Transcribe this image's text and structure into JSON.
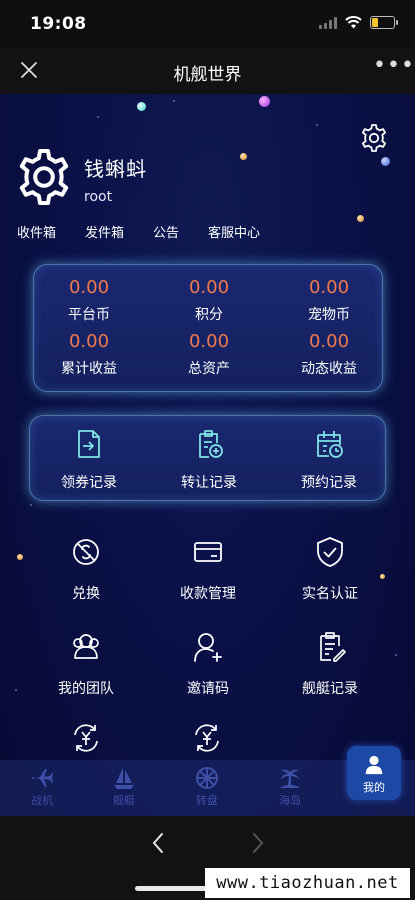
{
  "status_bar": {
    "time": "19:08"
  },
  "header": {
    "title": "机舰世界",
    "more": "•••"
  },
  "profile": {
    "username": "钱蝌蚪",
    "user_id": "root"
  },
  "quick_links": [
    "收件箱",
    "发件箱",
    "公告",
    "客服中心"
  ],
  "assets": [
    {
      "value": "0.00",
      "label": "平台币"
    },
    {
      "value": "0.00",
      "label": "积分"
    },
    {
      "value": "0.00",
      "label": "宠物币"
    },
    {
      "value": "0.00",
      "label": "累计收益"
    },
    {
      "value": "0.00",
      "label": "总资产"
    },
    {
      "value": "0.00",
      "label": "动态收益"
    }
  ],
  "records": [
    {
      "label": "领券记录",
      "icon": "voucher-record-icon"
    },
    {
      "label": "转让记录",
      "icon": "transfer-record-icon"
    },
    {
      "label": "预约记录",
      "icon": "reservation-record-icon"
    }
  ],
  "menu": [
    {
      "label": "兑换",
      "icon": "exchange-icon"
    },
    {
      "label": "收款管理",
      "icon": "card-icon"
    },
    {
      "label": "实名认证",
      "icon": "shield-check-icon"
    },
    {
      "label": "我的团队",
      "icon": "team-icon"
    },
    {
      "label": "邀请码",
      "icon": "add-user-icon"
    },
    {
      "label": "舰艇记录",
      "icon": "clipboard-edit-icon"
    }
  ],
  "tabs": [
    {
      "label": "战机",
      "icon": "plane-icon"
    },
    {
      "label": "舰艇",
      "icon": "sailboat-icon"
    },
    {
      "label": "转盘",
      "icon": "wheel-icon"
    },
    {
      "label": "海岛",
      "icon": "palm-island-icon"
    },
    {
      "label": "我的",
      "icon": "user-icon",
      "active": true
    }
  ],
  "watermark": "www.tiaozhuan.net",
  "colors": {
    "value": "#ee7a4c",
    "accent": "#7fe3e8",
    "background": "#0b124a",
    "active_tab": "#1d49a6"
  }
}
